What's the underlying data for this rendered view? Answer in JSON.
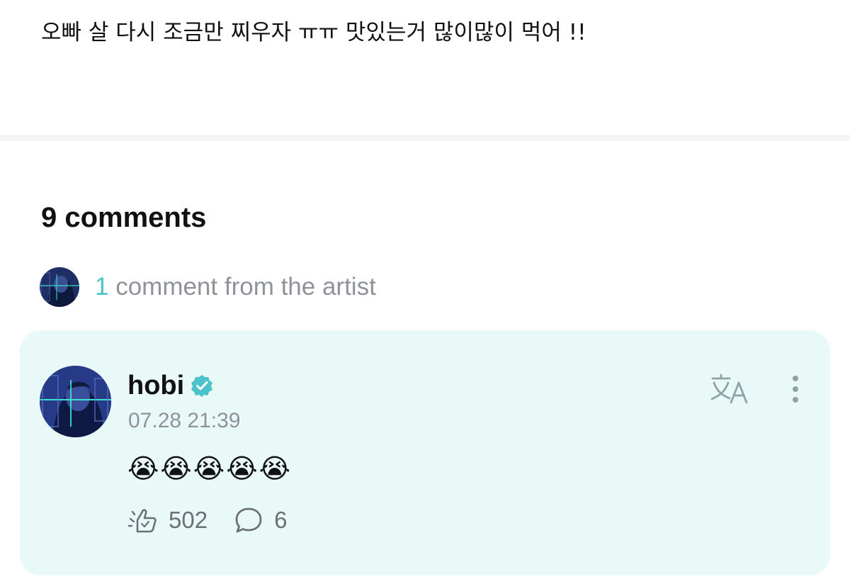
{
  "post": {
    "text": "오빠 살 다시 조금만 찌우자 ㅠㅠ 맛있는거 많이많이 먹어 !!"
  },
  "comments": {
    "heading": "9 comments",
    "artist_count": "1",
    "artist_label": " comment from the artist"
  },
  "artist_comment": {
    "author": "hobi",
    "timestamp": "07.28 21:39",
    "body": "😭😭😭😭😭",
    "like_count": "502",
    "reply_count": "6"
  },
  "icons": {
    "verified": "verified-badge-icon",
    "translate": "translate-icon",
    "more": "more-vertical-icon",
    "like": "like-icon",
    "reply": "reply-bubble-icon"
  },
  "colors": {
    "accent": "#4cc3c8",
    "card_background": "#e9f9f7",
    "muted_text": "#8f9399"
  }
}
